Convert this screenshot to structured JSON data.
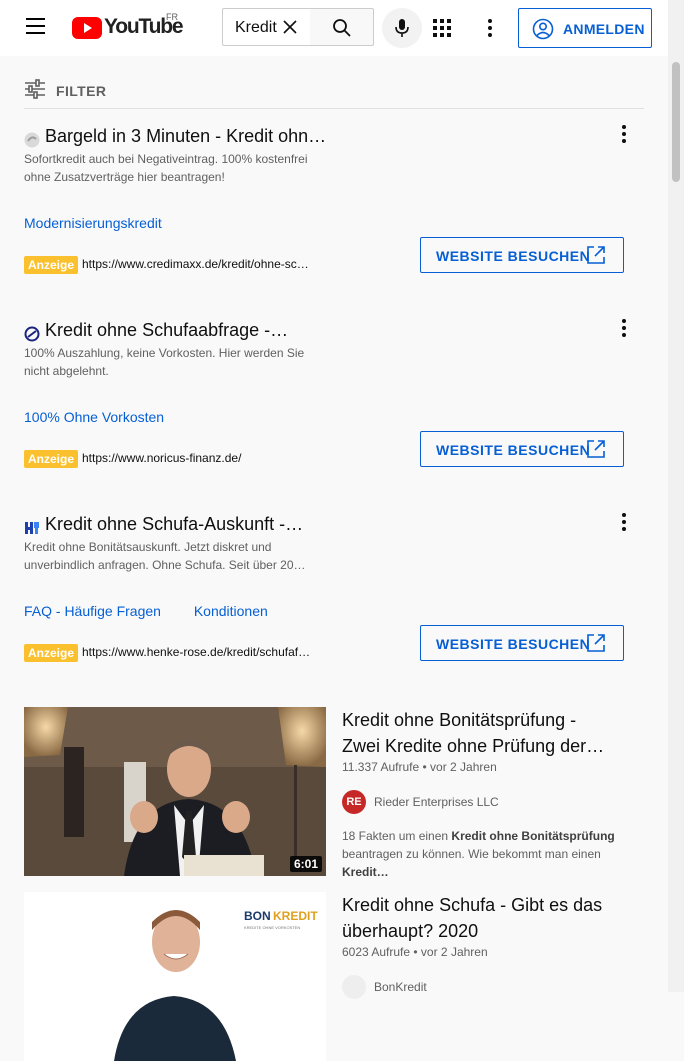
{
  "header": {
    "logo_text": "YouTube",
    "country_code": "FR",
    "search_value": "Kredit",
    "signin_label": "ANMELDEN"
  },
  "filter": {
    "label": "FILTER"
  },
  "ads": [
    {
      "title": "Bargeld in 3 Minuten - Kredit ohn…",
      "description": "Sofortkredit auch bei Negativeintrag. 100% kostenfrei ohne Zusatzverträge hier beantragen!",
      "links": [
        "Modernisierungskredit"
      ],
      "badge": "Anzeige",
      "url": "https://www.credimaxx.de/kredit/ohne-sc…",
      "cta": "WEBSITE BESUCHEN"
    },
    {
      "title": "Kredit ohne Schufaabfrage -…",
      "description": "100% Auszahlung, keine Vorkosten. Hier werden Sie nicht abgelehnt.",
      "links": [
        "100% Ohne Vorkosten"
      ],
      "badge": "Anzeige",
      "url": "https://www.noricus-finanz.de/",
      "cta": "WEBSITE BESUCHEN"
    },
    {
      "title": "Kredit ohne Schufa-Auskunft -…",
      "description": "Kredit ohne Bonitätsauskunft. Jetzt diskret und unverbindlich anfragen. Ohne Schufa. Seit über 20…",
      "links": [
        "FAQ - Häufige Fragen",
        "Konditionen"
      ],
      "badge": "Anzeige",
      "url": "https://www.henke-rose.de/kredit/schufaf…",
      "cta": "WEBSITE BESUCHEN"
    }
  ],
  "videos": [
    {
      "title": "Kredit ohne Bonitätsprüfung - Zwei Kredite ohne Prüfung der…",
      "meta": "11.337 Aufrufe • vor 2 Jahren",
      "channel": "Rieder Enterprises LLC",
      "channel_initials": "RE",
      "duration": "6:01",
      "desc_pre": "18 Fakten um einen ",
      "desc_bold1": "Kredit ohne Bonitätsprüfung",
      "desc_mid": " beantragen zu können. Wie bekommt man einen ",
      "desc_bold2": "Kredit…"
    },
    {
      "title": "Kredit ohne Schufa - Gibt es das überhaupt? 2020",
      "meta": "6023 Aufrufe • vor 2 Jahren",
      "channel": "BonKredit",
      "thumb_brand_1": "BON",
      "thumb_brand_2": "KREDIT",
      "thumb_tagline": "KREDITE OHNE VORKOSTEN"
    }
  ],
  "colors": {
    "brand_red": "#ff0000",
    "link_blue": "#065fd4",
    "ad_badge": "#fbc02d"
  }
}
